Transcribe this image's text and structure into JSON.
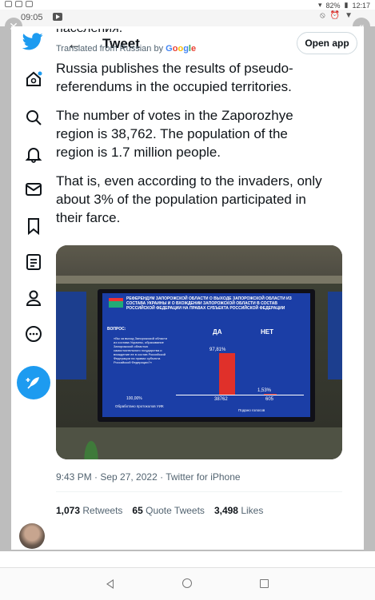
{
  "status_bar": {
    "time": "12:17",
    "battery": "82%"
  },
  "window": {
    "time": "09:05"
  },
  "header": {
    "title": "Tweet",
    "open_app": "Open app"
  },
  "tweet": {
    "cut_text": "населения.",
    "translated_prefix": "Translated from Russian by",
    "translated_brand": "Google",
    "paragraphs": [
      "Russia publishes the results of pseudo-referendums in the occupied territories.",
      "The number of votes in the Zaporozhye region is 38,762. The population of the region is 1.7 million people.",
      "That is, even according to the invaders, only about 3% of the population participated in their farce."
    ],
    "meta": "9:43 PM · Sep 27, 2022 · Twitter for iPhone",
    "stats": {
      "retweets_count": "1,073",
      "retweets_label": "Retweets",
      "quotes_count": "65",
      "quotes_label": "Quote Tweets",
      "likes_count": "3,498",
      "likes_label": "Likes"
    }
  },
  "media": {
    "headline": "РЕФЕРЕНДУМ ЗАПОРОЖСКОЙ ОБЛАСТИ О ВЫХОДЕ ЗАПОРОЖСКОЙ ОБЛАСТИ ИЗ СОСТАВА УКРАИНЫ И О ВХОЖДЕНИИ ЗАПОРОЖСКОЙ ОБЛАСТИ В СОСТАВ РОССИЙСКОЙ ФЕДЕРАЦИИ НА ПРАВАХ СУБЪЕКТА РОССИЙСКОЙ ФЕДЕРАЦИИ",
    "question_label": "ВОПРОС:",
    "question_text": "«Вы за выход Запорожской области из состава Украины, образование Запорожской областью самостоятельного государства и вхождение ее в состав Российской Федерации на правах субъекта Российской Федерации?»",
    "yes_label": "ДА",
    "no_label": "НЕТ",
    "yes_pct": "97,81%",
    "no_pct": "1,53%",
    "yes_votes": "38762",
    "no_votes": "605",
    "total_pct": "100,00%",
    "processed_label": "Обработано протоколов УИК",
    "votes_label": "Подано голосов"
  },
  "icons": {
    "bird": "twitter-bird-icon",
    "accent": "#1d9bf0"
  }
}
